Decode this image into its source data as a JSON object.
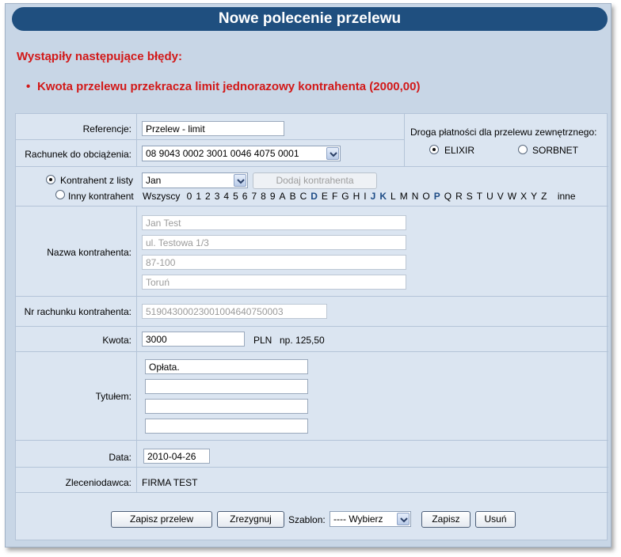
{
  "title": "Nowe polecenie przelewu",
  "errors": {
    "heading": "Wystąpiły następujące błędy:",
    "items": [
      "Kwota przelewu przekracza limit jednorazowy kontrahenta (2000,00)"
    ]
  },
  "form": {
    "referencja": {
      "label": "Referencje:",
      "value": "Przelew - limit"
    },
    "rachunek": {
      "label": "Rachunek do obciążenia:",
      "value": "08 9043 0002 3001 0046 4075 0001"
    },
    "droga": {
      "label": "Droga płatności dla przelewu zewnętrznego:",
      "options": [
        "ELIXIR",
        "SORBNET"
      ],
      "selected": "ELIXIR"
    },
    "kontrahent": {
      "option_list": "Kontrahent z listy",
      "option_other": "Inny kontrahent",
      "selected": "Kontrahent z listy",
      "select_value": "Jan",
      "add_button": "Dodaj kontrahenta",
      "alphabet_all": "Wszyscy",
      "alphabet": [
        "0",
        "1",
        "2",
        "3",
        "4",
        "5",
        "6",
        "7",
        "8",
        "9",
        "A",
        "B",
        "C",
        "D",
        "E",
        "F",
        "G",
        "H",
        "I",
        "J",
        "K",
        "L",
        "M",
        "N",
        "O",
        "P",
        "Q",
        "R",
        "S",
        "T",
        "U",
        "V",
        "W",
        "X",
        "Y",
        "Z"
      ],
      "alphabet_highlighted": [
        "D",
        "J",
        "K",
        "P"
      ],
      "alphabet_other": "inne"
    },
    "nazwa": {
      "label": "Nazwa kontrahenta:",
      "lines": [
        "Jan Test",
        "ul. Testowa 1/3",
        "87-100",
        "Toruń"
      ]
    },
    "nr_rachunku": {
      "label": "Nr rachunku kontrahenta:",
      "value": "51904300023001004640750003"
    },
    "kwota": {
      "label": "Kwota:",
      "value": "3000",
      "currency": "PLN",
      "hint": "np. 125,50"
    },
    "tytul": {
      "label": "Tytułem:",
      "lines": [
        "Opłata.",
        "",
        "",
        ""
      ]
    },
    "data": {
      "label": "Data:",
      "value": "2010-04-26"
    },
    "zleceniodawca": {
      "label": "Zleceniodawca:",
      "value": "FIRMA TEST"
    }
  },
  "actions": {
    "save": "Zapisz przelew",
    "cancel": "Zrezygnuj",
    "template_label": "Szablon:",
    "template_value": "---- Wybierz",
    "template_save": "Zapisz",
    "template_delete": "Usuń"
  },
  "colors": {
    "title_bg": "#1f4f7f",
    "error": "#d21919",
    "panel_bg": "#dbe5f1",
    "frame_bg": "#c8d6e6"
  }
}
